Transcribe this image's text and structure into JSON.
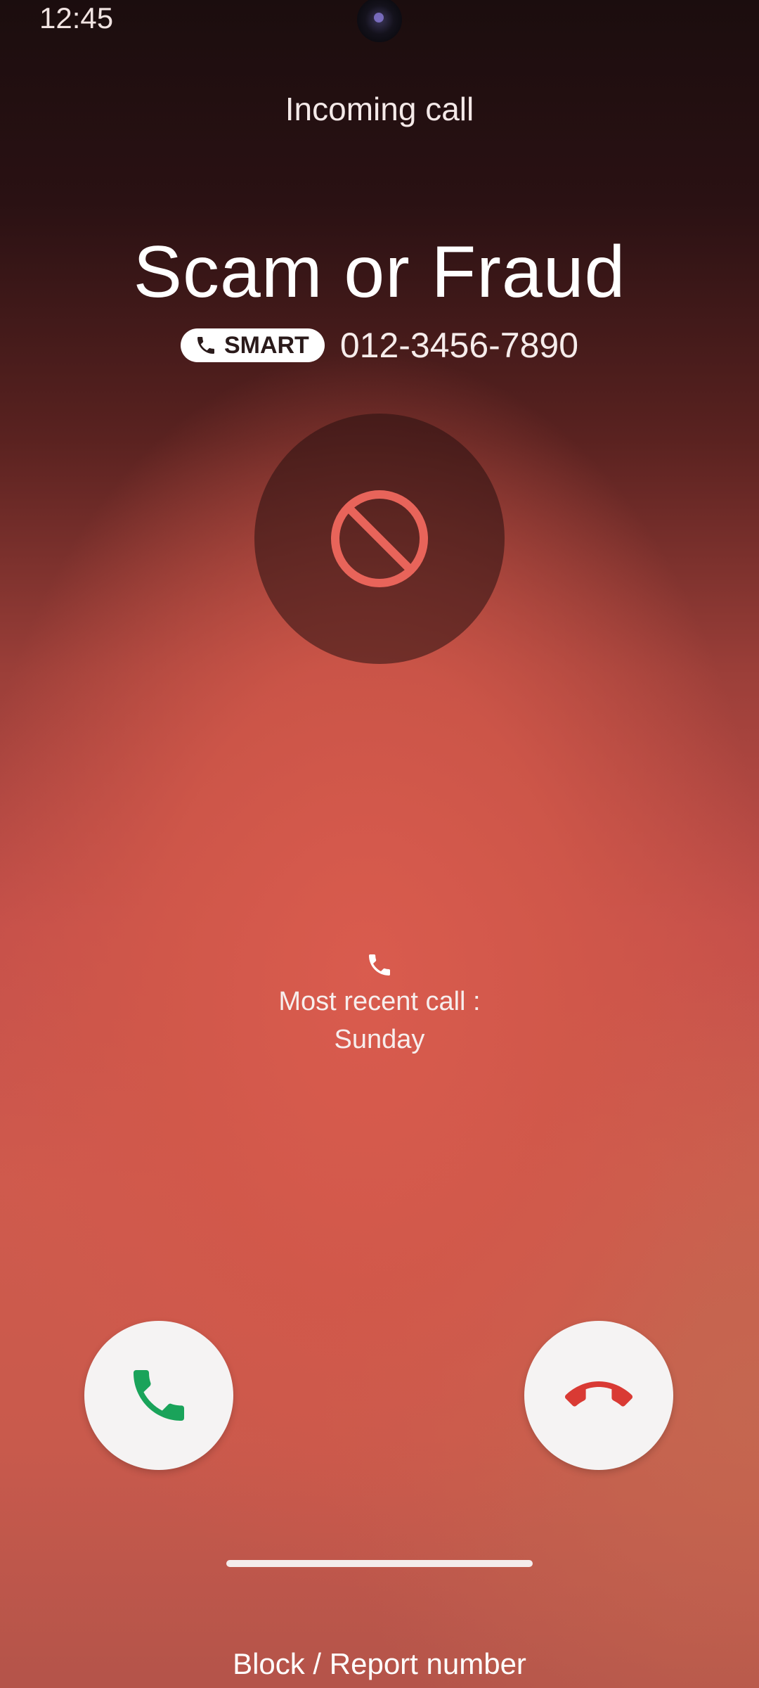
{
  "status_bar": {
    "time": "12:45"
  },
  "call": {
    "label": "Incoming call",
    "caller_name": "Scam or Fraud",
    "badge_label": "SMART",
    "phone_number": "012-3456-7890",
    "status_icon": "block-icon"
  },
  "recent_call": {
    "icon": "phone-icon",
    "label": "Most recent call :",
    "day": "Sunday"
  },
  "actions": {
    "answer_icon": "phone-answer-icon",
    "decline_icon": "phone-decline-icon",
    "block_report_label": "Block / Report number"
  },
  "colors": {
    "block_icon": "#e8645a",
    "answer_icon": "#1aa35a",
    "decline_icon": "#d93a34",
    "button_bg": "#f5f3f3"
  }
}
